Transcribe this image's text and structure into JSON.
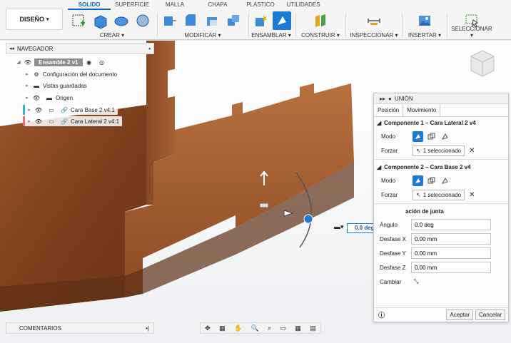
{
  "toolbar": {
    "design_label": "DISEÑO",
    "tabs": [
      {
        "label": "SOLIDO"
      },
      {
        "label": "SUPERFICIE"
      },
      {
        "label": "MALLA"
      },
      {
        "label": "CHAPA"
      },
      {
        "label": "PLÁSTICO"
      },
      {
        "label": "UTILIDADES"
      }
    ],
    "groups": [
      {
        "label": "CREAR"
      },
      {
        "label": "MODIFICAR"
      },
      {
        "label": "ENSAMBLAR"
      },
      {
        "label": "CONSTRUIR"
      },
      {
        "label": "INSPECCIONAR"
      },
      {
        "label": "INSERTAR"
      },
      {
        "label": "SELECCIONAR"
      }
    ]
  },
  "browser": {
    "title": "NAVEGADOR",
    "items": [
      {
        "label": "Ensamble 2 v1"
      },
      {
        "label": "Configuración del documento"
      },
      {
        "label": "Vistas guardadas"
      },
      {
        "label": "Origen"
      },
      {
        "label": "Cara Base 2 v4:1"
      },
      {
        "label": "Cara Lateral 2 v4:1"
      }
    ]
  },
  "comments": {
    "label": "COMENTARIOS"
  },
  "viewport": {
    "angle_value": "0.0 deg"
  },
  "joint_panel": {
    "title": "UNIÓN",
    "tabs": [
      {
        "label": "Posición"
      },
      {
        "label": "Movimiento"
      }
    ],
    "component1": {
      "title": "Componente 1 – Cara Lateral 2 v4",
      "mode_label": "Modo",
      "force_label": "Forzar",
      "selection": "1 seleccionado"
    },
    "component2": {
      "title": "Componente 2 – Cara Base 2 v4",
      "mode_label": "Modo",
      "force_label": "Forzar",
      "selection": "1 seleccionado"
    },
    "alignment": {
      "title": "ación de junta"
    },
    "fields": [
      {
        "label": "Ángulo",
        "value": "0.0 deg"
      },
      {
        "label": "Desfase X",
        "value": "0.00 mm"
      },
      {
        "label": "Desfase Y",
        "value": "0.00 mm"
      },
      {
        "label": "Desfase Z",
        "value": "0.00 mm"
      }
    ],
    "flip_label": "Cambiar",
    "accept_label": "Aceptar",
    "cancel_label": "Cancelar"
  },
  "colors": {
    "accent": "#1f7ad6",
    "wood": "#8a4a25"
  }
}
